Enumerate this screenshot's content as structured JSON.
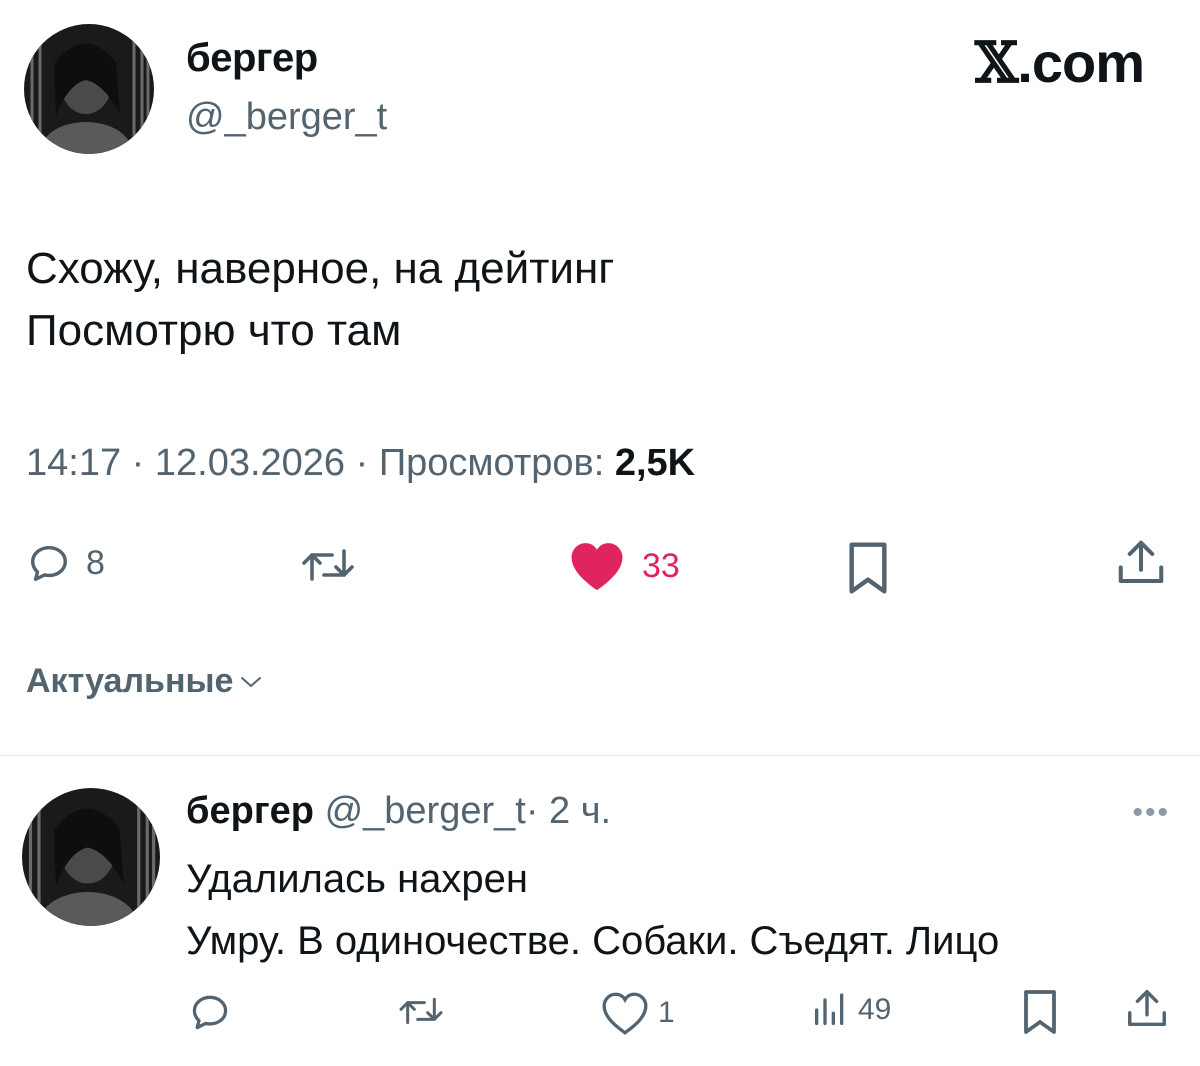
{
  "brand": {
    "wordmark_mark": "𝕏",
    "wordmark_text": ".com"
  },
  "tweet": {
    "author_name": "бергер",
    "author_handle": "@_berger_t",
    "text_lines": [
      "Схожу, наверное, на дейтинг",
      "Посмотрю что там"
    ],
    "time": "14:17",
    "date": "12.03.2026",
    "views_label": "Просмотров:",
    "views_count": "2,5K",
    "separator": "·",
    "actions": {
      "reply_count": "8",
      "like_count": "33",
      "reply_icon": "reply-icon",
      "retweet_icon": "retweet-icon",
      "like_icon": "heart-filled-icon",
      "bookmark_icon": "bookmark-icon",
      "share_icon": "share-icon"
    }
  },
  "replies_sort": {
    "label": "Актуальные",
    "icon": "chevron-down-icon"
  },
  "reply": {
    "author_name": "бергер",
    "author_handle": "@_berger_t",
    "separator": "·",
    "time_ago": "2 ч.",
    "more": "•••",
    "text_lines": [
      "Удалилась нахрен",
      "Умру. В одиночестве. Собаки. Съедят. Лицо"
    ],
    "actions": {
      "like_count": "1",
      "views_count": "49"
    }
  },
  "colors": {
    "text_primary": "#0f1419",
    "text_secondary": "#536471",
    "like_pink": "#e0245e",
    "divider": "#e7e9ea"
  }
}
